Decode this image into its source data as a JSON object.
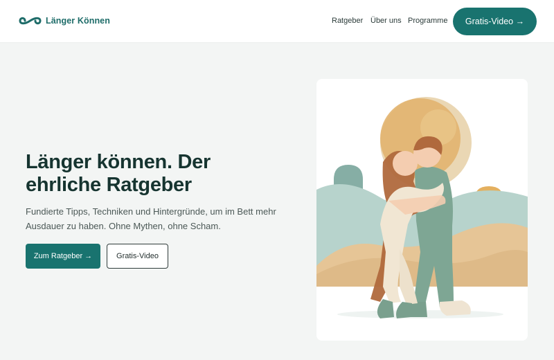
{
  "header": {
    "brand": "Länger Können",
    "nav": [
      "Ratgeber",
      "Über uns",
      "Programme"
    ],
    "cta": "Gratis-Video →"
  },
  "hero": {
    "title": "Länger können. Der ehrliche Ratgeber",
    "subtitle": "Fundierte Tipps, Techniken und Hintergründe, um im Bett mehr Ausdauer zu haben. Ohne Mythen, ohne Scham.",
    "primary_button": "Zum Ratgeber →",
    "secondary_button": "Gratis-Video"
  },
  "colors": {
    "brand": "#19736f",
    "background": "#f3f5f4",
    "heading": "#163430"
  },
  "icons": {
    "logo": "infinity-icon"
  },
  "illustration": {
    "subject": "embracing-couple-illustration"
  }
}
